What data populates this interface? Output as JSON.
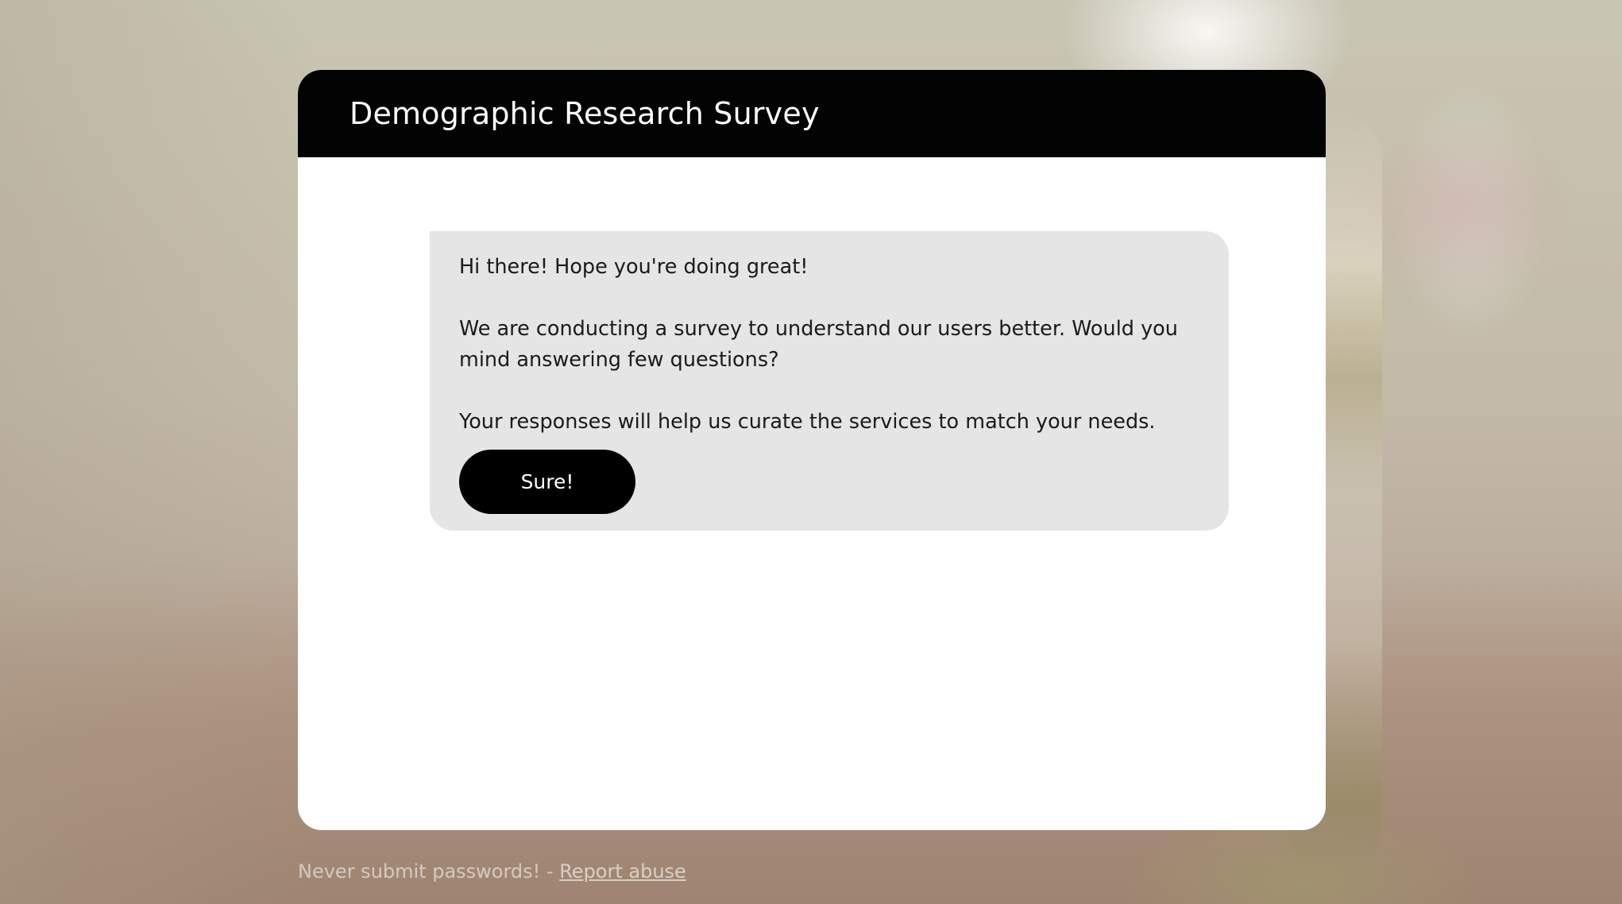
{
  "survey": {
    "title": "Demographic Research Survey"
  },
  "message": {
    "greeting": "Hi there! Hope you're doing great!",
    "request": "We are conducting a survey to understand our users better. Would you mind answering few questions?",
    "purpose": "Your responses will help us curate the services to match your needs.",
    "accept_label": "Sure!"
  },
  "footer": {
    "warning": "Never submit passwords! - ",
    "report_label": "Report abuse"
  },
  "colors": {
    "header_bg": "#030303",
    "bubble_bg": "#e5e5e5",
    "button_bg": "#000000",
    "card_bg": "#ffffff"
  }
}
